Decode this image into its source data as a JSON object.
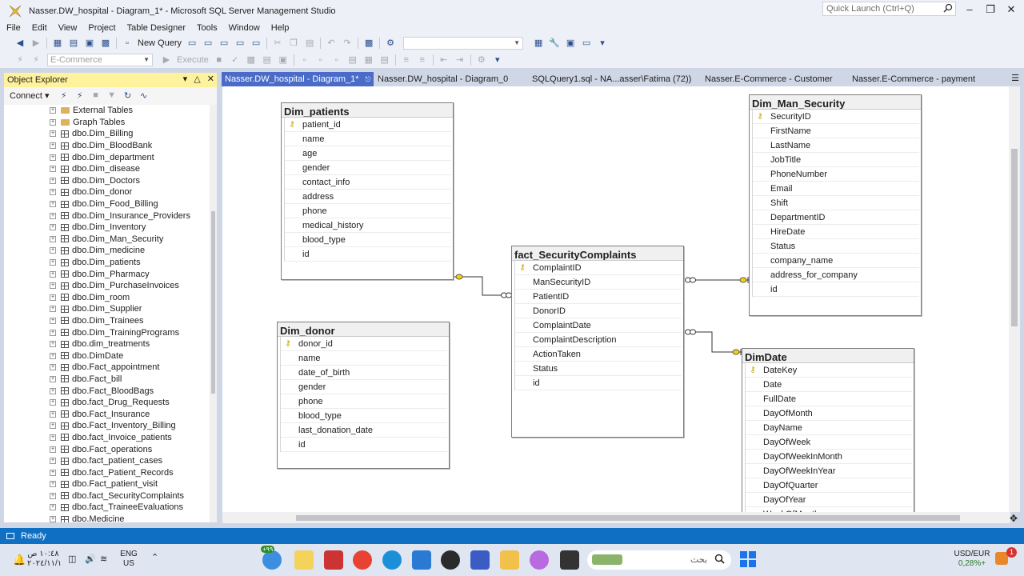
{
  "window": {
    "title": "Nasser.DW_hospital - Diagram_1* - Microsoft SQL Server Management Studio",
    "quick_launch_placeholder": "Quick Launch (Ctrl+Q)"
  },
  "menu": [
    "File",
    "Edit",
    "View",
    "Project",
    "Table Designer",
    "Tools",
    "Window",
    "Help"
  ],
  "toolbar": {
    "new_query_label": "New Query",
    "database_combo_value": "E-Commerce",
    "execute_label": "Execute"
  },
  "object_explorer": {
    "title": "Object Explorer",
    "connect_label": "Connect",
    "items": [
      {
        "label": "External Tables",
        "type": "folder"
      },
      {
        "label": "Graph Tables",
        "type": "folder"
      },
      {
        "label": "dbo.Dim_Billing",
        "type": "table"
      },
      {
        "label": "dbo.Dim_BloodBank",
        "type": "table"
      },
      {
        "label": "dbo.Dim_department",
        "type": "table"
      },
      {
        "label": "dbo.Dim_disease",
        "type": "table"
      },
      {
        "label": "dbo.Dim_Doctors",
        "type": "table"
      },
      {
        "label": "dbo.Dim_donor",
        "type": "table"
      },
      {
        "label": "dbo.Dim_Food_Billing",
        "type": "table"
      },
      {
        "label": "dbo.Dim_Insurance_Providers",
        "type": "table"
      },
      {
        "label": "dbo.Dim_Inventory",
        "type": "table"
      },
      {
        "label": "dbo.Dim_Man_Security",
        "type": "table"
      },
      {
        "label": "dbo.Dim_medicine",
        "type": "table"
      },
      {
        "label": "dbo.Dim_patients",
        "type": "table"
      },
      {
        "label": "dbo.Dim_Pharmacy",
        "type": "table"
      },
      {
        "label": "dbo.Dim_PurchaseInvoices",
        "type": "table"
      },
      {
        "label": "dbo.Dim_room",
        "type": "table"
      },
      {
        "label": "dbo.Dim_Supplier",
        "type": "table"
      },
      {
        "label": "dbo.Dim_Trainees",
        "type": "table"
      },
      {
        "label": "dbo.Dim_TrainingPrograms",
        "type": "table"
      },
      {
        "label": "dbo.dim_treatments",
        "type": "table"
      },
      {
        "label": "dbo.DimDate",
        "type": "table"
      },
      {
        "label": "dbo.Fact_appointment",
        "type": "table"
      },
      {
        "label": "dbo.Fact_bill",
        "type": "table"
      },
      {
        "label": "dbo.Fact_BloodBags",
        "type": "table"
      },
      {
        "label": "dbo.fact_Drug_Requests",
        "type": "table"
      },
      {
        "label": "dbo.Fact_Insurance",
        "type": "table"
      },
      {
        "label": "dbo.Fact_Inventory_Billing",
        "type": "table"
      },
      {
        "label": "dbo.fact_Invoice_patients",
        "type": "table"
      },
      {
        "label": "dbo.Fact_operations",
        "type": "table"
      },
      {
        "label": "dbo.fact_patient_cases",
        "type": "table"
      },
      {
        "label": "dbo.fact_Patient_Records",
        "type": "table"
      },
      {
        "label": "dbo.Fact_patient_visit",
        "type": "table"
      },
      {
        "label": "dbo.fact_SecurityComplaints",
        "type": "table"
      },
      {
        "label": "dbo.fact_TraineeEvaluations",
        "type": "table"
      },
      {
        "label": "dbo.Medicine",
        "type": "table"
      }
    ]
  },
  "doc_tabs": [
    {
      "label": "Nasser.DW_hospital - Diagram_1*",
      "active": true
    },
    {
      "label": "Nasser.DW_hospital - Diagram_0",
      "active": false
    },
    {
      "label": "SQLQuery1.sql - NA...asser\\Fatima (72))",
      "active": false
    },
    {
      "label": "Nasser.E-Commerce - Customer",
      "active": false
    },
    {
      "label": "Nasser.E-Commerce - payment",
      "active": false
    }
  ],
  "diagram": {
    "dim_patients": {
      "name": "Dim_patients",
      "columns": [
        "patient_id",
        "name",
        "age",
        "gender",
        "contact_info",
        "address",
        "phone",
        "medical_history",
        "blood_type",
        "id"
      ]
    },
    "dim_donor": {
      "name": "Dim_donor",
      "columns": [
        "donor_id",
        "name",
        "date_of_birth",
        "gender",
        "phone",
        "blood_type",
        "last_donation_date",
        "id"
      ]
    },
    "fact_security": {
      "name": "fact_SecurityComplaints",
      "columns": [
        "ComplaintID",
        "ManSecurityID",
        "PatientID",
        "DonorID",
        "ComplaintDate",
        "ComplaintDescription",
        "ActionTaken",
        "Status",
        "id"
      ]
    },
    "dim_man_security": {
      "name": "Dim_Man_Security",
      "columns": [
        "SecurityID",
        "FirstName",
        "LastName",
        "JobTitle",
        "PhoneNumber",
        "Email",
        "Shift",
        "DepartmentID",
        "HireDate",
        "Status",
        "company_name",
        "address_for_company",
        "id"
      ]
    },
    "dimdate": {
      "name": "DimDate",
      "columns": [
        "DateKey",
        "Date",
        "FullDate",
        "DayOfMonth",
        "DayName",
        "DayOfWeek",
        "DayOfWeekInMonth",
        "DayOfWeekInYear",
        "DayOfQuarter",
        "DayOfYear",
        "WeekOfMonth"
      ]
    }
  },
  "status": {
    "text": "Ready"
  },
  "taskbar": {
    "time": "١٠:٤٨ ص",
    "date": "٢٠٢٤/١١/١",
    "language": "ENG",
    "region": "US",
    "search_placeholder": "بحث",
    "currency_label": "USD/EUR",
    "currency_value": "0,28%+",
    "weather_badge": "+٩٩",
    "notification_count": "1"
  }
}
